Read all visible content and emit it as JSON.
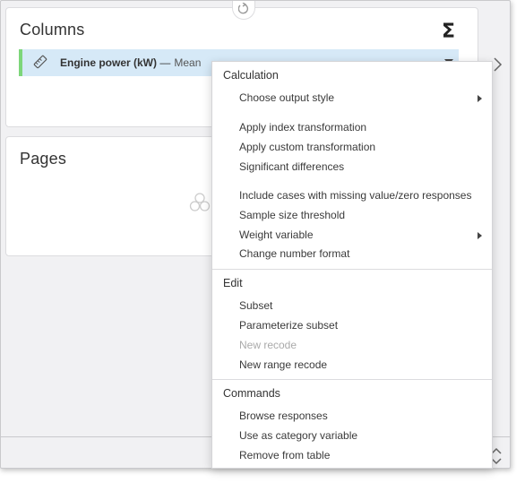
{
  "columns_panel": {
    "title": "Columns",
    "chip": {
      "variable": "Engine power (kW)",
      "separator": "—",
      "statistic": "Mean"
    }
  },
  "pages_panel": {
    "title": "Pages"
  },
  "icons": {
    "sigma": "Σ",
    "rotate": "rotate-icon",
    "ruler": "ruler-icon",
    "chevron_right": "chevron-right-icon",
    "up_down": "up-down-icon",
    "circles": "circles-icon"
  },
  "colors": {
    "chip_background": "#d6e9f7",
    "chip_accent": "#7dd67a",
    "disabled_text": "#aaaaaa"
  },
  "menu": {
    "calculation": {
      "heading": "Calculation",
      "items": [
        "Choose output style",
        "Apply index transformation",
        "Apply custom transformation",
        "Significant differences",
        "Include cases with missing value/zero responses",
        "Sample size threshold",
        "Weight variable",
        "Change number format"
      ]
    },
    "edit": {
      "heading": "Edit",
      "items": [
        "Subset",
        "Parameterize subset",
        "New recode",
        "New range recode"
      ]
    },
    "commands": {
      "heading": "Commands",
      "items": [
        "Browse responses",
        "Use as category variable",
        "Remove from table"
      ]
    }
  }
}
